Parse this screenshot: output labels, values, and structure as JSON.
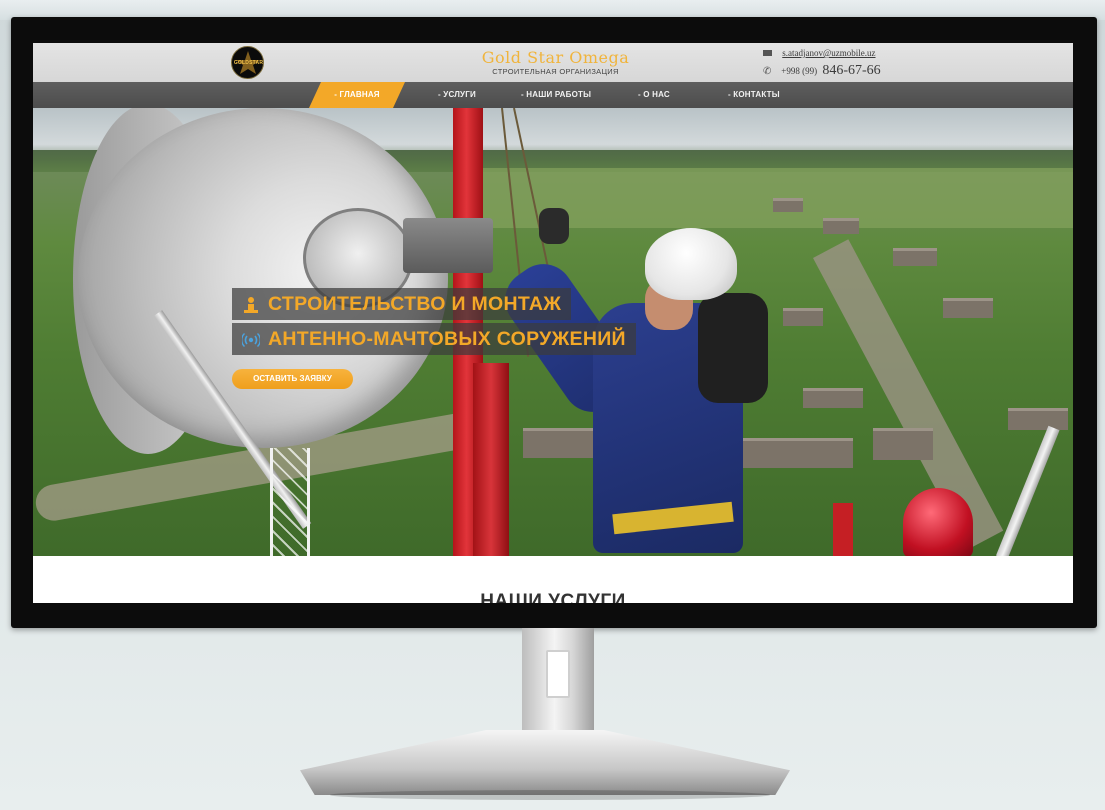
{
  "header": {
    "logo_text": "GOLDSTAR",
    "brand_name": "Gold Star Omega",
    "brand_subtitle": "СТРОИТЕЛЬНАЯ ОРГАНИЗАЦИЯ",
    "email": "s.atadjanov@uzmobile.uz",
    "phone_prefix": "+998 (99)",
    "phone_number": "846-67-66"
  },
  "nav": {
    "items": [
      {
        "label": "- ГЛАВНАЯ",
        "active": true
      },
      {
        "label": "- УСЛУГИ",
        "active": false
      },
      {
        "label": "- НАШИ РАБОТЫ",
        "active": false
      },
      {
        "label": "- О НАС",
        "active": false
      },
      {
        "label": "- КОНТАКТЫ",
        "active": false
      }
    ]
  },
  "hero": {
    "title_line1": "СТРОИТЕЛЬСТВО И МОНТАЖ",
    "title_line2": "АНТЕННО-МАЧТОВЫХ СОРУЖЕНИЙ",
    "cta_label": "ОСТАВИТЬ ЗАЯВКУ",
    "icons": [
      "worker-icon",
      "signal-icon"
    ]
  },
  "sections": {
    "services_title": "НАШИ УСЛУГИ"
  },
  "colors": {
    "accent": "#f3a828",
    "nav_bg": "#555555",
    "header_bg": "#dddddd"
  }
}
